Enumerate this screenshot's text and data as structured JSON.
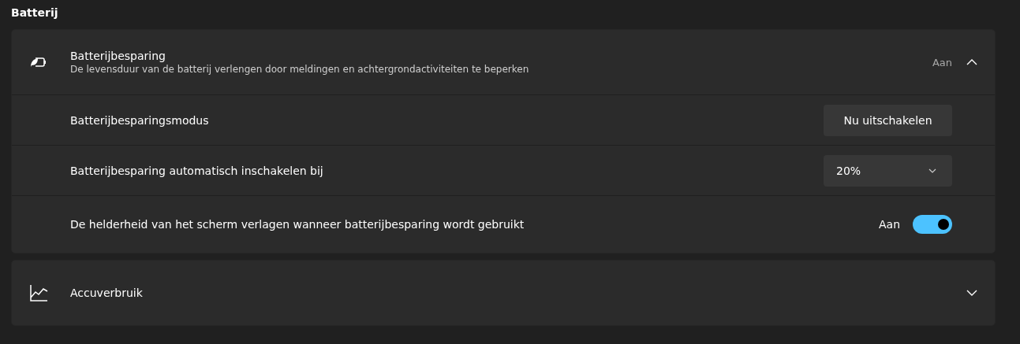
{
  "section_title": "Batterij",
  "groups": [
    {
      "title": "Batterijbesparing",
      "description": "De levensduur van de batterij verlengen door meldingen en achtergrondactiviteiten te beperken",
      "status": "Aan",
      "expanded": true,
      "settings": [
        {
          "kind": "button",
          "label": "Batterijbesparingsmodus",
          "button": "Nu uitschakelen"
        },
        {
          "kind": "dropdown",
          "label": "Batterijbesparing automatisch inschakelen bij",
          "value": "20%"
        },
        {
          "kind": "toggle",
          "label": "De helderheid van het scherm verlagen wanneer batterijbesparing wordt gebruikt",
          "state_text": "Aan",
          "on": true
        }
      ]
    },
    {
      "title": "Accuverbruik",
      "expanded": false
    }
  ]
}
